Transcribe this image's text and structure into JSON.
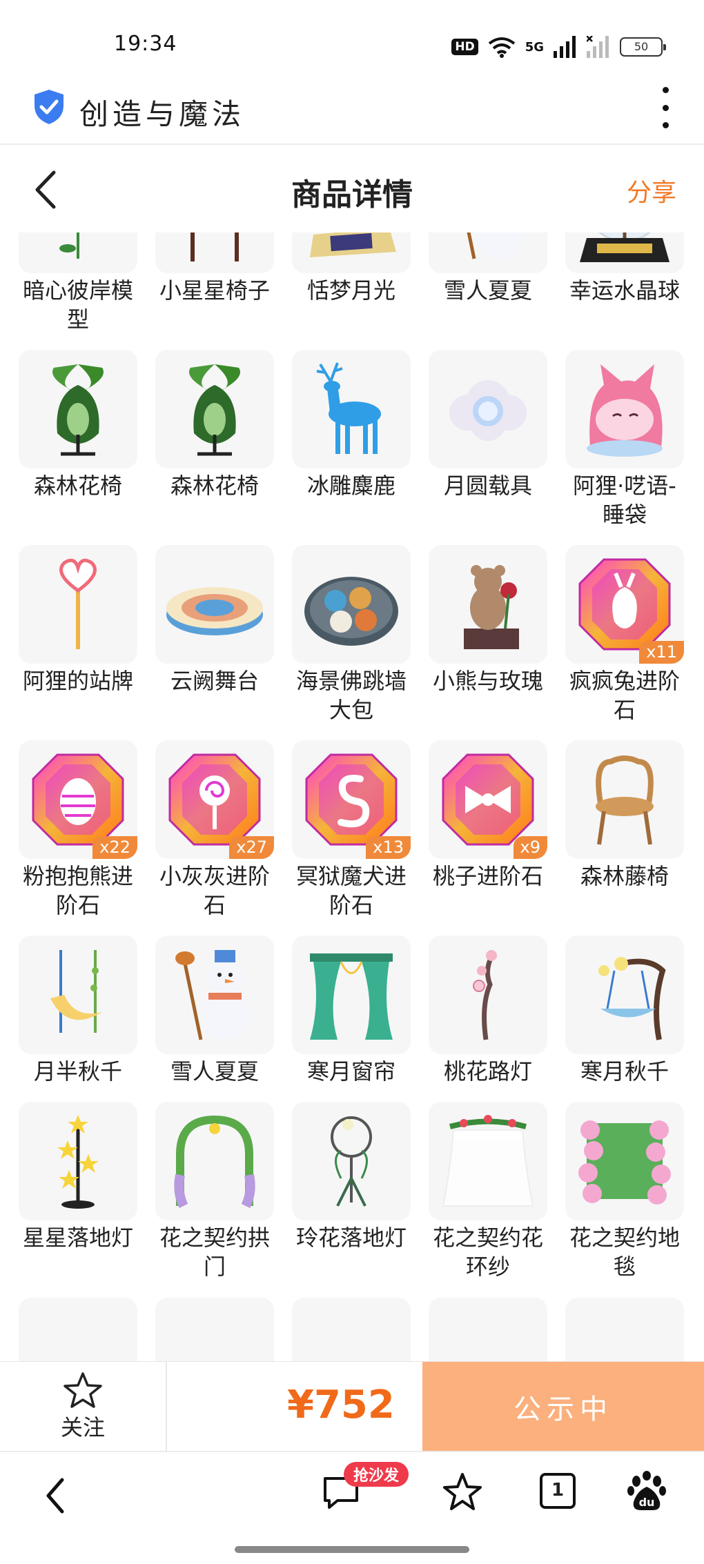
{
  "status_bar": {
    "time": "19:34",
    "hd": "HD",
    "network": "5G",
    "battery": "50"
  },
  "app": {
    "title": "创造与魔法"
  },
  "page": {
    "title": "商品详情",
    "share_label": "分享"
  },
  "items": [
    {
      "name": "暗心彼岸模型",
      "icon": "red-flower",
      "count": ""
    },
    {
      "name": "小星星椅子",
      "icon": "star-chair",
      "count": ""
    },
    {
      "name": "恬梦月光",
      "icon": "moon-swing",
      "count": ""
    },
    {
      "name": "雪人夏夏",
      "icon": "snowman",
      "count": ""
    },
    {
      "name": "幸运水晶球",
      "icon": "crystal-ball",
      "count": ""
    },
    {
      "name": "森林花椅",
      "icon": "forest-chair",
      "count": ""
    },
    {
      "name": "森林花椅",
      "icon": "forest-chair",
      "count": ""
    },
    {
      "name": "冰雕麋鹿",
      "icon": "ice-deer",
      "count": ""
    },
    {
      "name": "月圆载具",
      "icon": "moon-cloud",
      "count": ""
    },
    {
      "name": "阿狸·呓语-睡袋",
      "icon": "fox-sleeping-bag",
      "count": ""
    },
    {
      "name": "阿狸的站牌",
      "icon": "heart-sign",
      "count": ""
    },
    {
      "name": "云阙舞台",
      "icon": "round-stage",
      "count": ""
    },
    {
      "name": "海景佛跳墙大包",
      "icon": "buns-plate",
      "count": ""
    },
    {
      "name": "小熊与玫瑰",
      "icon": "bear-rose",
      "count": ""
    },
    {
      "name": "疯疯兔进阶石",
      "icon": "gem-rabbit",
      "count": "x11"
    },
    {
      "name": "粉抱抱熊进阶石",
      "icon": "gem-egg",
      "count": "x22"
    },
    {
      "name": "小灰灰进阶石",
      "icon": "gem-lollipop",
      "count": "x27"
    },
    {
      "name": "冥狱魔犬进阶石",
      "icon": "gem-swirl",
      "count": "x13"
    },
    {
      "name": "桃子进阶石",
      "icon": "gem-bow",
      "count": "x9"
    },
    {
      "name": "森林藤椅",
      "icon": "rattan-chair",
      "count": ""
    },
    {
      "name": "月半秋千",
      "icon": "crescent-swing",
      "count": ""
    },
    {
      "name": "雪人夏夏",
      "icon": "snowman",
      "count": ""
    },
    {
      "name": "寒月窗帘",
      "icon": "curtain",
      "count": ""
    },
    {
      "name": "桃花路灯",
      "icon": "blossom-lamp",
      "count": ""
    },
    {
      "name": "寒月秋千",
      "icon": "tree-swing",
      "count": ""
    },
    {
      "name": "星星落地灯",
      "icon": "star-lamp",
      "count": ""
    },
    {
      "name": "花之契约拱门",
      "icon": "flower-arch",
      "count": ""
    },
    {
      "name": "玲花落地灯",
      "icon": "hoop-lamp",
      "count": ""
    },
    {
      "name": "花之契约花环纱",
      "icon": "veil",
      "count": ""
    },
    {
      "name": "花之契约地毯",
      "icon": "flower-rug",
      "count": ""
    }
  ],
  "action_bar": {
    "follow_label": "关注",
    "price": "¥752",
    "status_label": "公示中"
  },
  "browser_bar": {
    "badge_label": "抢沙发",
    "tab_count": "1"
  },
  "colors": {
    "accent": "#f07a28",
    "price": "#f06a1a",
    "button": "#fbb07e",
    "badge": "#f08a3a"
  }
}
